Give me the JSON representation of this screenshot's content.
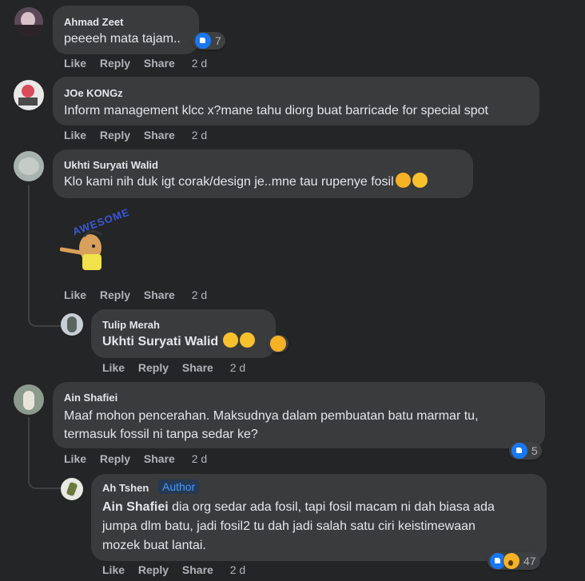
{
  "actions": {
    "like": "Like",
    "reply": "Reply",
    "share": "Share"
  },
  "comments": [
    {
      "name": "Ahmad Zeet",
      "text": "peeeeh mata tajam..",
      "time": "2 d",
      "reactions": "7"
    },
    {
      "name": "JOe KONGz",
      "text": "Inform management klcc x?mane tahu diorg buat barricade for special spot",
      "time": "2 d"
    },
    {
      "name": "Ukhti Suryati Walid",
      "text": "Klo kami nih duk igt corak/design je..mne tau rupenye fosil",
      "time": "2 d",
      "sticker_text": "AWESOME"
    },
    {
      "name": "Tulip Merah",
      "tag": "Ukhti Suryati Walid",
      "time": "2 d"
    },
    {
      "name": "Ain Shafiei",
      "lines": [
        "Maaf mohon pencerahan. Maksudnya dalam pembuatan batu marmar tu,",
        "termasuk fossil ni tanpa sedar ke?"
      ],
      "time": "2 d",
      "reactions": "5"
    },
    {
      "name": "Ah Tshen",
      "badge": "Author",
      "tag": "Ain Shafiei",
      "lines": [
        " dia org sedar ada fosil, tapi fosil macam ni dah biasa ada",
        "jumpa dlm batu, jadi fosil2 tu dah jadi salah satu ciri keistimewaan",
        "mozek buat lantai."
      ],
      "time": "2 d",
      "reactions": "47"
    }
  ],
  "colors": {
    "background": "#242526",
    "bubble": "#3a3b3c",
    "like": "#1877f2",
    "author": "#4599ff"
  }
}
